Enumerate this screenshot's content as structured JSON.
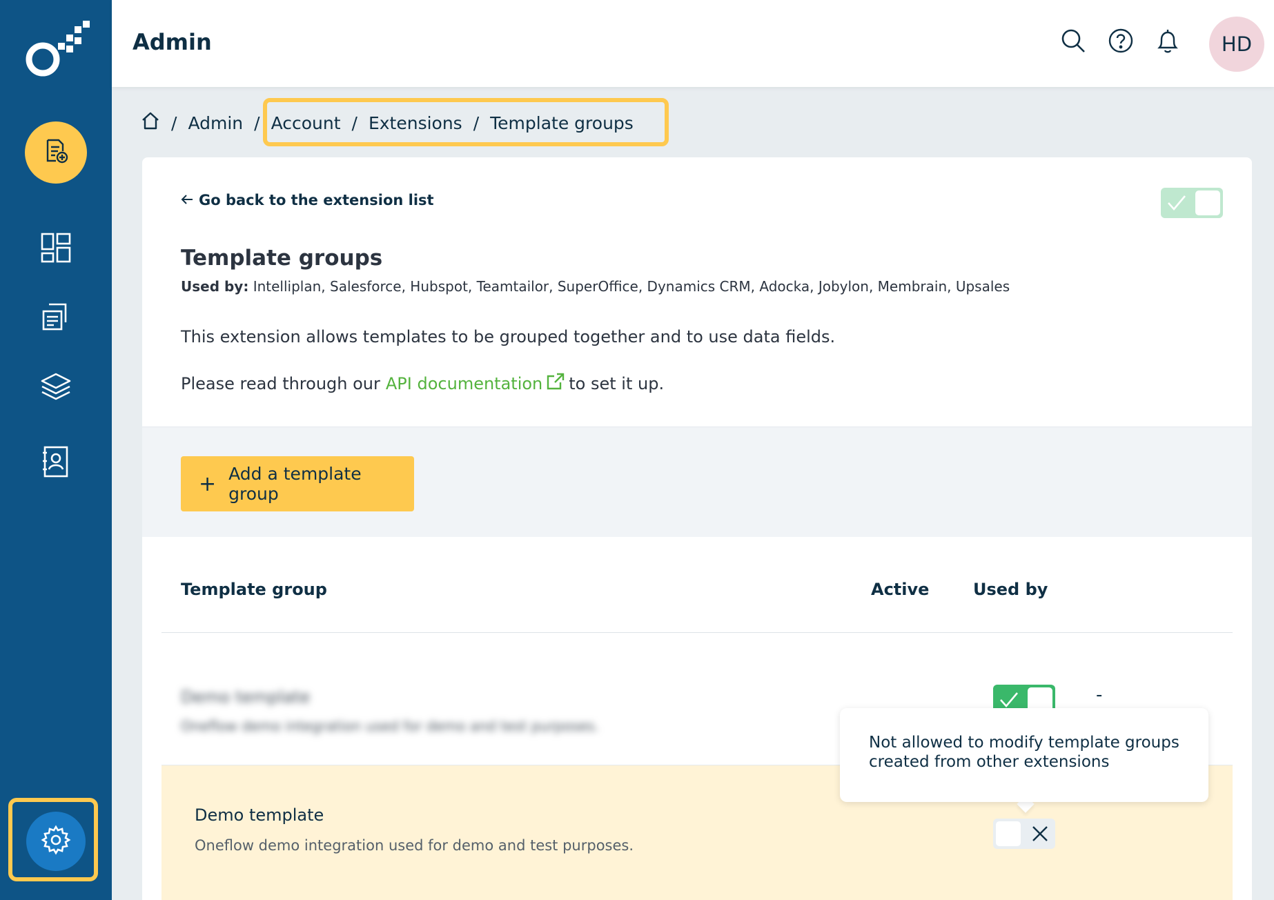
{
  "header": {
    "title": "Admin",
    "avatar_initials": "HD"
  },
  "breadcrumb": {
    "items": [
      "Admin",
      "Account",
      "Extensions",
      "Template groups"
    ],
    "separator": "/"
  },
  "extension": {
    "back_label": "Go back to the extension list",
    "title": "Template groups",
    "used_by_label": "Used by:",
    "used_by_value": "Intelliplan, Salesforce, Hubspot, Teamtailor, SuperOffice, Dynamics CRM, Adocka, Jobylon, Membrain, Upsales",
    "description": "This extension allows templates to be grouped together and to use data fields.",
    "doc_before": "Please read through our",
    "doc_link": "API documentation",
    "doc_after": "to set it up.",
    "enabled": true
  },
  "actions": {
    "add_label": "Add a template group",
    "add_icon": "+"
  },
  "table": {
    "columns": [
      "Template group",
      "Active",
      "Used by"
    ],
    "rows": [
      {
        "name": "Demo template",
        "description": "Oneflow demo integration used for demo and test purposes.",
        "active": true,
        "used_by": "-"
      },
      {
        "name": "Demo template",
        "description": "Oneflow demo integration used for demo and test purposes.",
        "active": false,
        "used_by": ""
      }
    ]
  },
  "tooltip": {
    "text": "Not allowed to modify template groups created from other extensions"
  },
  "colors": {
    "sidebar": "#0e5486",
    "accent": "#fec94f",
    "link": "#54b33e",
    "toggle_on": "#3ab86a",
    "highlight_row": "#fff3d6"
  }
}
